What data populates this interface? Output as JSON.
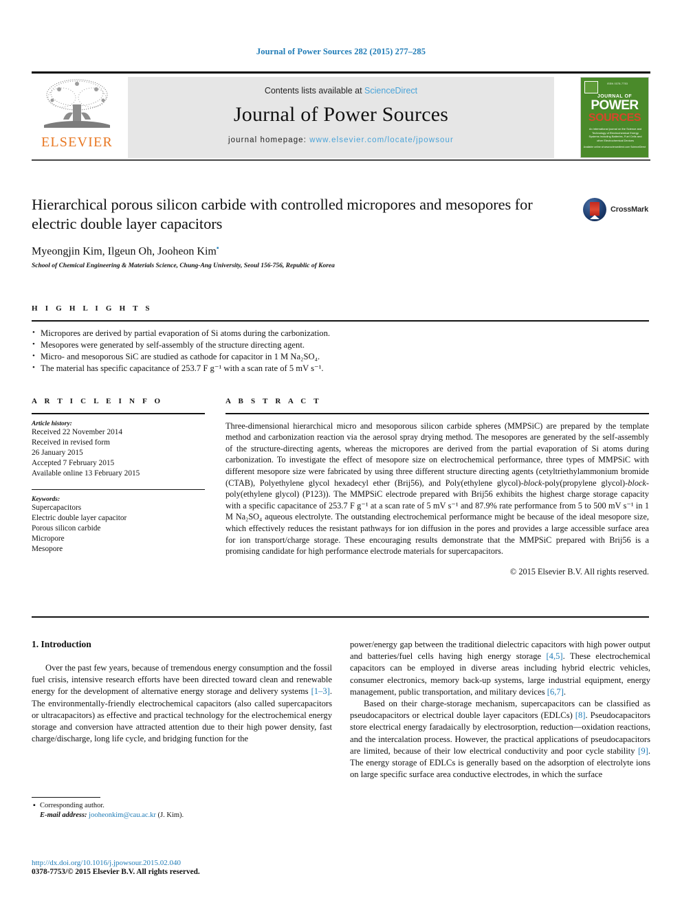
{
  "running_head": "Journal of Power Sources 282 (2015) 277–285",
  "masthead": {
    "contents_prefix": "Contents lists available at ",
    "sciencedirect": "ScienceDirect",
    "journal_title": "Journal of Power Sources",
    "homepage_label": "journal homepage: ",
    "homepage_url": "www.elsevier.com/locate/jpowsour",
    "publisher": "ELSEVIER",
    "cover": {
      "tiny_top": "ISSN 0378-7753",
      "line1": "JOURNAL OF",
      "line2": "POWER",
      "line3": "SOURCES",
      "sub": "An international journal on the Science and Technology of Electrochemical Energy Systems including Batteries, Fuel Cells and other Electrochemical Devices",
      "foot": "Available online at www.sciencedirect.com\nScienceDirect"
    }
  },
  "article": {
    "title": "Hierarchical porous silicon carbide with controlled micropores and mesopores for electric double layer capacitors",
    "authors": "Myeongjin Kim, Ilgeun Oh, Jooheon Kim",
    "affiliation": "School of Chemical Engineering & Materials Science, Chung-Ang University, Seoul 156-756, Republic of Korea",
    "crossmark_label": "CrossMark"
  },
  "highlights": {
    "label": "H I G H L I G H T S",
    "items": [
      "Micropores are derived by partial evaporation of Si atoms during the carbonization.",
      "Mesopores were generated by self-assembly of the structure directing agent.",
      "Micro- and mesoporous SiC are studied as cathode for capacitor in 1 M Na₂SO₄.",
      "The material has specific capacitance of 253.7 F g⁻¹ with a scan rate of 5 mV s⁻¹."
    ]
  },
  "article_info": {
    "label": "A R T I C L E  I N F O",
    "history_label": "Article history:",
    "history": [
      "Received 22 November 2014",
      "Received in revised form",
      "26 January 2015",
      "Accepted 7 February 2015",
      "Available online 13 February 2015"
    ],
    "keywords_label": "Keywords:",
    "keywords": [
      "Supercapacitors",
      "Electric double layer capacitor",
      "Porous silicon carbide",
      "Micropore",
      "Mesopore"
    ]
  },
  "abstract": {
    "label": "A B S T R A C T",
    "paragraphs": [
      "Three-dimensional hierarchical micro and mesoporous silicon carbide spheres (MMPSiC) are prepared by the template method and carbonization reaction via the aerosol spray drying method. The mesopores are generated by the self-assembly of the structure-directing agents, whereas the micropores are derived from the partial evaporation of Si atoms during carbonization. To investigate the effect of mesopore size on electrochemical performance, three types of MMPSiC with different mesopore size were fabricated by using three different structure directing agents (cetyltriethylammonium bromide (CTAB), Polyethylene glycol hexadecyl ether (Brij56), and Poly(ethylene glycol)-block-poly(propylene glycol)-block-poly(ethylene glycol) (P123)). The MMPSiC electrode prepared with Brij56 exhibits the highest charge storage capacity with a specific capacitance of 253.7 F g⁻¹ at a scan rate of 5 mV s⁻¹ and 87.9% rate performance from 5 to 500 mV s⁻¹ in 1 M Na₂SO₄ aqueous electrolyte. The outstanding electrochemical performance might be because of the ideal mesopore size, which effectively reduces the resistant pathways for ion diffusion in the pores and provides a large accessible surface area for ion transport/charge storage. These encouraging results demonstrate that the MMPSiC prepared with Brij56 is a promising candidate for high performance electrode materials for supercapacitors."
    ],
    "copyright": "© 2015 Elsevier B.V. All rights reserved."
  },
  "introduction": {
    "heading": "1.  Introduction",
    "left_paragraph": "Over the past few years, because of tremendous energy consumption and the fossil fuel crisis, intensive research efforts have been directed toward clean and renewable energy for the development of alternative energy storage and delivery systems [1–3]. The environmentally-friendly electrochemical capacitors (also called supercapacitors or ultracapacitors) as effective and practical technology for the electrochemical energy storage and conversion have attracted attention due to their high power density, fast charge/discharge, long life cycle, and bridging function for the",
    "right_paragraph_1": "power/energy gap between the traditional dielectric capacitors with high power output and batteries/fuel cells having high energy storage [4,5]. These electrochemical capacitors can be employed in diverse areas including hybrid electric vehicles, consumer electronics, memory back-up systems, large industrial equipment, energy management, public transportation, and military devices [6,7].",
    "right_paragraph_2": "Based on their charge-storage mechanism, supercapacitors can be classified as pseudocapacitors or electrical double layer capacitors (EDLCs) [8]. Pseudocapacitors store electrical energy faradaically by electrosorption, reduction—oxidation reactions, and the intercalation process. However, the practical applications of pseudocapacitors are limited, because of their low electrical conductivity and poor cycle stability [9]. The energy storage of EDLCs is generally based on the adsorption of electrolyte ions on large specific surface area conductive electrodes, in which the surface"
  },
  "footnote": {
    "corresponding": "Corresponding author.",
    "email_label": "E-mail address:",
    "email": "jooheonkim@cau.ac.kr",
    "email_suffix": "(J. Kim)."
  },
  "footer": {
    "doi": "http://dx.doi.org/10.1016/j.jpowsour.2015.02.040",
    "issn": "0378-7753/© 2015 Elsevier B.V. All rights reserved."
  },
  "colors": {
    "link": "#1f7bb6",
    "sciencedirect": "#4aa3d8",
    "elsevier_orange": "#e87722",
    "cover_green": "#4a8a2a",
    "band_gray": "#e6e6e6"
  }
}
